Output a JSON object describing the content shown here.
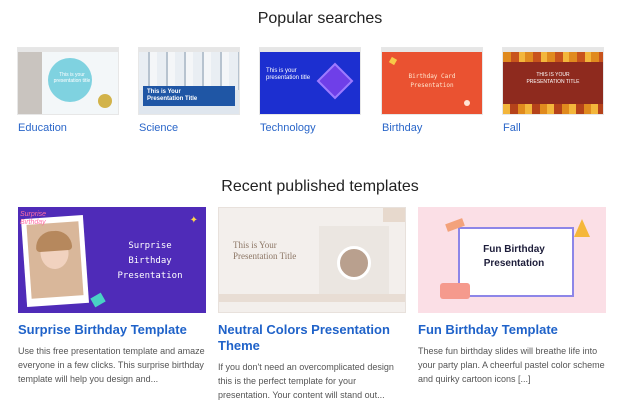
{
  "popular": {
    "title": "Popular searches",
    "items": [
      {
        "label": "Education",
        "thumb_text": "This is your presentation title"
      },
      {
        "label": "Science",
        "thumb_text": "This is Your Presentation Title"
      },
      {
        "label": "Technology",
        "thumb_text": "This is your presentation title"
      },
      {
        "label": "Birthday",
        "thumb_text": "Birthday Card Presentation"
      },
      {
        "label": "Fall",
        "thumb_text": "THIS IS YOUR PRESENTATION TITLE"
      }
    ]
  },
  "recent": {
    "title": "Recent published templates",
    "items": [
      {
        "title": "Surprise Birthday Template",
        "thumb_text": "Surprise Birthday Presentation",
        "sticker": "Surprise Birthday",
        "desc": "Use this free presentation template and amaze everyone in a few clicks. This surprise birthday template will help you design and..."
      },
      {
        "title": "Neutral Colors Presentation Theme",
        "thumb_text": "This is Your Presentation Title",
        "desc": "If you don't need an overcomplicated design this is the perfect template for your presentation. Your content will stand out..."
      },
      {
        "title": "Fun Birthday Template",
        "thumb_text": "Fun Birthday Presentation",
        "desc": "These fun birthday slides will breathe life into your party plan. A cheerful pastel color scheme and quirky cartoon icons [...]"
      }
    ]
  }
}
